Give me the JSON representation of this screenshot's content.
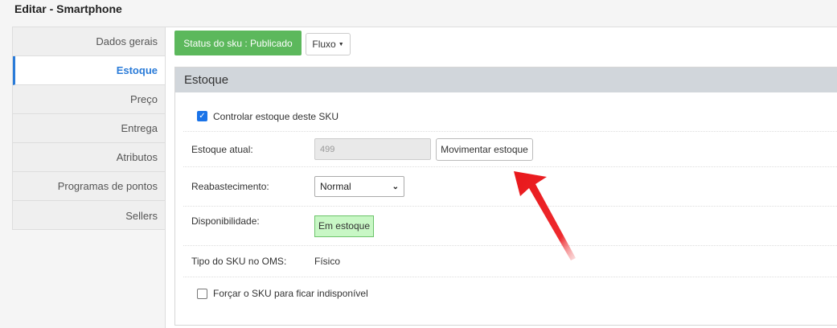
{
  "page": {
    "title": "Editar - Smartphone"
  },
  "sidebar": {
    "items": [
      {
        "label": "Dados gerais"
      },
      {
        "label": "Estoque"
      },
      {
        "label": "Preço"
      },
      {
        "label": "Entrega"
      },
      {
        "label": "Atributos"
      },
      {
        "label": "Programas de pontos"
      },
      {
        "label": "Sellers"
      }
    ]
  },
  "toolbar": {
    "status": "Status do sku : Publicado",
    "flow_label": "Fluxo"
  },
  "panel": {
    "title": "Estoque",
    "control_stock": {
      "label": "Controlar estoque deste SKU",
      "checked": true
    },
    "current_stock": {
      "label": "Estoque atual:",
      "value": "499",
      "button": "Movimentar estoque"
    },
    "restock": {
      "label": "Reabastecimento:",
      "selected": "Normal"
    },
    "availability": {
      "label": "Disponibilidade:",
      "value": "Em estoque"
    },
    "oms_type": {
      "label": "Tipo do SKU no OMS:",
      "value": "Físico"
    },
    "force_unavailable": {
      "label": "Forçar o SKU para ficar indisponível",
      "checked": false
    }
  },
  "colors": {
    "accent": "#2a7bd8",
    "status_green": "#5cb85c",
    "availability_bg": "#c8f7c5",
    "arrow_red": "#e8171b"
  }
}
